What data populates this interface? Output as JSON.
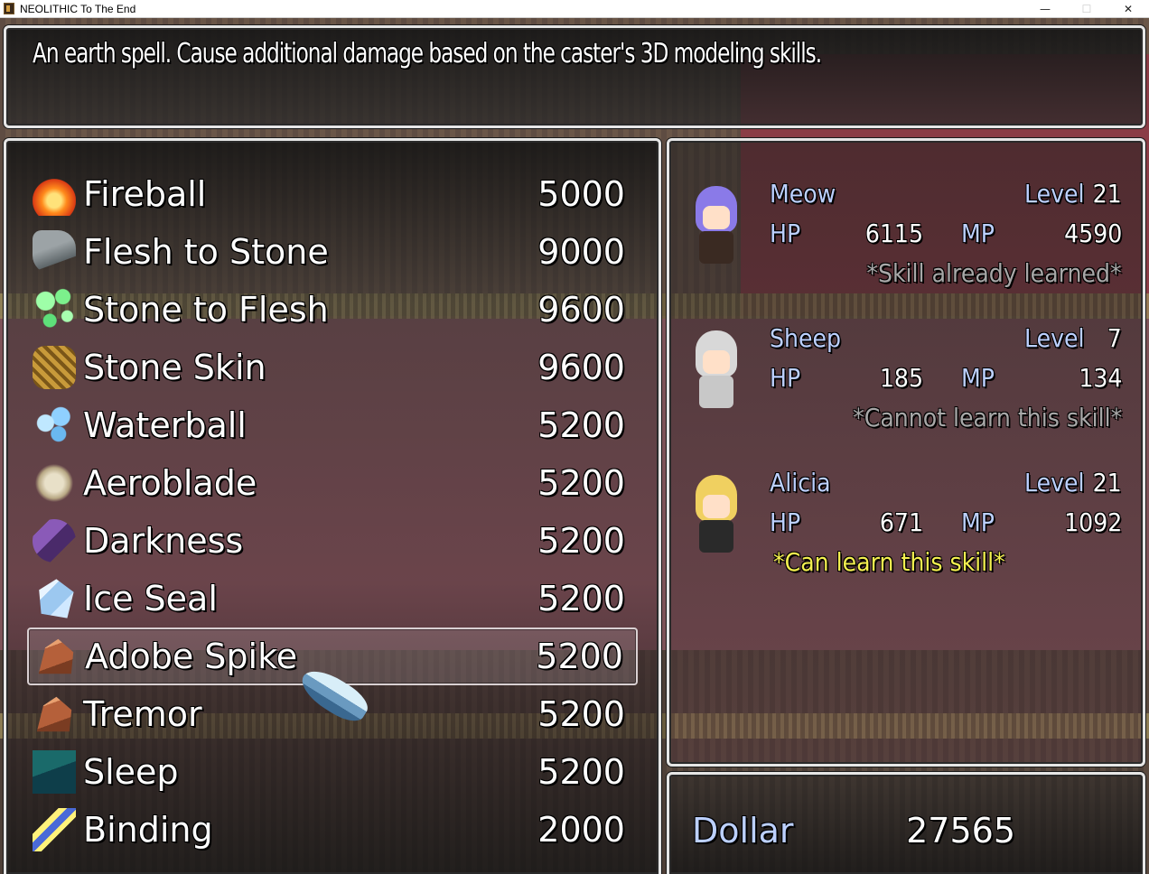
{
  "window": {
    "title": "NEOLITHIC To The End",
    "minimize": "—",
    "maximize": "☐",
    "close": "✕"
  },
  "help": {
    "text": "An earth spell. Cause additional damage based on the caster's 3D modeling skills."
  },
  "skills": [
    {
      "name": "Fireball",
      "cost": "5000",
      "icon": "fire-icon"
    },
    {
      "name": "Flesh to Stone",
      "cost": "9000",
      "icon": "stone-statue-icon"
    },
    {
      "name": "Stone to Flesh",
      "cost": "9600",
      "icon": "green-bubbles-icon"
    },
    {
      "name": "Stone Skin",
      "cost": "9600",
      "icon": "stone-fist-icon"
    },
    {
      "name": "Waterball",
      "cost": "5200",
      "icon": "water-splash-icon"
    },
    {
      "name": "Aeroblade",
      "cost": "5200",
      "icon": "wind-swirl-icon"
    },
    {
      "name": "Darkness",
      "cost": "5200",
      "icon": "dark-wave-icon"
    },
    {
      "name": "Ice Seal",
      "cost": "5200",
      "icon": "ice-crystal-icon"
    },
    {
      "name": "Adobe Spike",
      "cost": "5200",
      "icon": "rock-spike-icon"
    },
    {
      "name": "Tremor",
      "cost": "5200",
      "icon": "rock-spike-icon"
    },
    {
      "name": "Sleep",
      "cost": "5200",
      "icon": "sleep-icon"
    },
    {
      "name": "Binding",
      "cost": "2000",
      "icon": "lightning-bind-icon"
    }
  ],
  "selected_index": 8,
  "party": [
    {
      "name": "Meow",
      "level_label": "Level",
      "level": "21",
      "hp_label": "HP",
      "hp": "6115",
      "mp_label": "MP",
      "mp": "4590",
      "status": "*Skill already learned*",
      "status_type": "learned"
    },
    {
      "name": "Sheep",
      "level_label": "Level",
      "level": "7",
      "hp_label": "HP",
      "hp": "185",
      "mp_label": "MP",
      "mp": "134",
      "status": "*Cannot learn this skill*",
      "status_type": "cannot"
    },
    {
      "name": "Alicia",
      "level_label": "Level",
      "level": "21",
      "hp_label": "HP",
      "hp": "671",
      "mp_label": "MP",
      "mp": "1092",
      "status": "*Can learn this skill*",
      "status_type": "can"
    }
  ],
  "gold": {
    "label": "Dollar",
    "value": "27565"
  },
  "colors": {
    "system_blue": "#bcd0ff",
    "can_learn": "#f4f050",
    "disabled_grey": "#a8a8a8",
    "window_border": "#e6e6e6"
  }
}
